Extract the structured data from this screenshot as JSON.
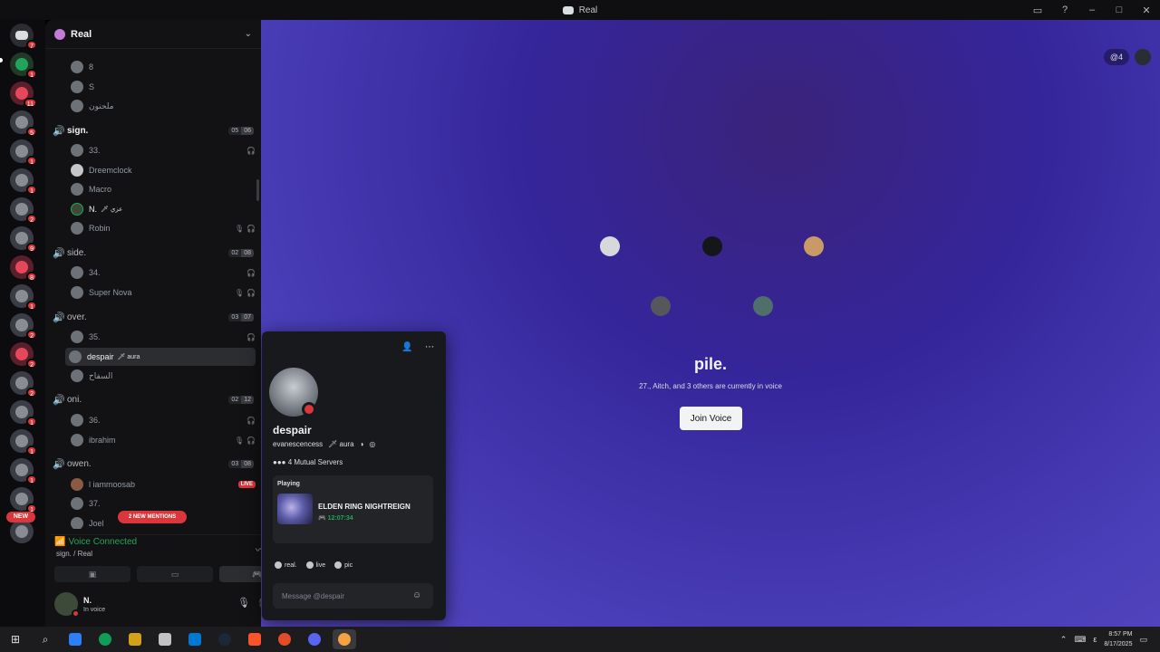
{
  "window": {
    "title": "Real"
  },
  "colors": {
    "accent": "#5865f2",
    "danger": "#da373c",
    "online": "#23a559",
    "dnd": "#da373c",
    "live": "#da373c"
  },
  "rail": {
    "badges": [
      "7",
      "1",
      "11",
      "5",
      "1",
      "1",
      "2",
      "9",
      "8",
      "1",
      "2",
      "2",
      "2",
      "1",
      "1",
      "1",
      "1",
      "1"
    ],
    "new_label": "NEW"
  },
  "sidebar": {
    "guild_name": "Real",
    "scroll_icons": [
      "chevron-down-icon"
    ],
    "top_users": [
      {
        "name": "8"
      },
      {
        "name": "S"
      },
      {
        "name": "ملحنون"
      }
    ],
    "channels": [
      {
        "name": "sign.",
        "count_a": "05",
        "count_b": "06",
        "users": [
          {
            "name": "33.",
            "icon": "red"
          },
          {
            "name": "Dreemclock"
          },
          {
            "name": "Macro"
          },
          {
            "name": "N.",
            "tag": "🗡 عزي"
          },
          {
            "name": "Robin",
            "icons": [
              "mic-muted-icon",
              "headphones-muted-icon"
            ]
          }
        ]
      },
      {
        "name": "side.",
        "count_a": "02",
        "count_b": "08",
        "users": [
          {
            "name": "34.",
            "icon": "red"
          },
          {
            "name": "Super Nova",
            "icons": [
              "mic-muted-icon",
              "headphones-muted-icon"
            ]
          }
        ]
      },
      {
        "name": "over.",
        "count_a": "03",
        "count_b": "07",
        "users": [
          {
            "name": "35.",
            "icon": "red"
          },
          {
            "name": "despair",
            "tag": "🗡 aura",
            "selected": true
          },
          {
            "name": "السفاح"
          }
        ]
      },
      {
        "name": "oni.",
        "count_a": "02",
        "count_b": "12",
        "users": [
          {
            "name": "36.",
            "icon": "red"
          },
          {
            "name": "ibrahim",
            "icons": [
              "mic-muted-icon",
              "headphones-muted-icon"
            ]
          }
        ]
      },
      {
        "name": "owen.",
        "count_a": "03",
        "count_b": "08",
        "users": [
          {
            "name": "l iammoosab",
            "live": "LIVE"
          },
          {
            "name": "37."
          },
          {
            "name": "Joel"
          }
        ]
      }
    ],
    "mentions_pill": "2 NEW MENTIONS"
  },
  "voice": {
    "status": "Voice Connected",
    "location": "sign. / Real"
  },
  "user": {
    "name": "N.",
    "status": "In voice"
  },
  "main": {
    "mention_chip": "@4",
    "tile_colors": [
      "#22223a",
      "#2f3338",
      "#6b4e3a",
      "#2a2a2e",
      "#233c3c"
    ],
    "title": "pile.",
    "subtitle": "27., Aitch, and 3 others are currently in voice",
    "join_label": "Join Voice"
  },
  "profile": {
    "display_name": "despair",
    "username": "evanescencess",
    "tag": "🗡 aura",
    "mutual": "4 Mutual Servers",
    "activity_label": "Playing",
    "game": "ELDEN RING NIGHTREIGN",
    "elapsed": "12:07:34",
    "roles": [
      "real.",
      "live",
      "pic"
    ],
    "message_placeholder": "Message @despair"
  },
  "taskbar": {
    "lang": "ε",
    "time": "8:57 PM",
    "date": "8/17/2025",
    "app_colors": [
      "#2d7ff9",
      "#0f9d58",
      "#d4a017",
      "#c2c2c2",
      "#0078d4",
      "#1b2838",
      "#fb542b",
      "#e34c26",
      "#5865f2",
      "#f4a340"
    ]
  }
}
